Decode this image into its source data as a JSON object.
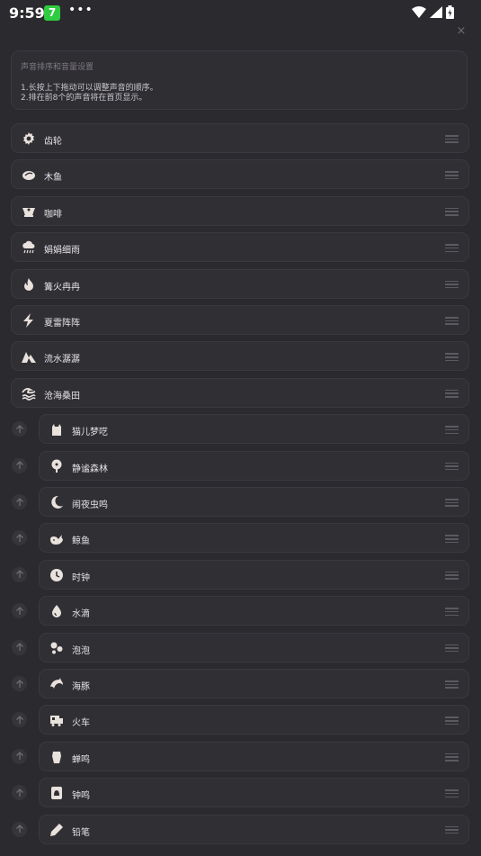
{
  "status_bar": {
    "time": "9:59",
    "app_badge": "7",
    "more": "•••"
  },
  "close_label": "×",
  "info": {
    "title": "声音排序和音量设置",
    "line1": "1.长按上下拖动可以调整声音的顺序。",
    "line2": "2.排在前8个的声音将在首页显示。"
  },
  "top_items": [
    {
      "label": "齿轮",
      "icon": "gear-icon"
    },
    {
      "label": "木鱼",
      "icon": "wooden-fish-icon"
    },
    {
      "label": "咖啡",
      "icon": "coffee-icon"
    },
    {
      "label": "娟娟细雨",
      "icon": "rain-cloud-icon"
    },
    {
      "label": "篝火冉冉",
      "icon": "fire-icon"
    },
    {
      "label": "夏雷阵阵",
      "icon": "lightning-icon"
    },
    {
      "label": "流水潺潺",
      "icon": "mountain-stream-icon"
    },
    {
      "label": "沧海桑田",
      "icon": "wave-icon"
    }
  ],
  "other_items": [
    {
      "label": "猫儿梦呓",
      "icon": "cat-icon"
    },
    {
      "label": "静谧森林",
      "icon": "tree-icon"
    },
    {
      "label": "闹夜虫鸣",
      "icon": "moon-icon"
    },
    {
      "label": "鲸鱼",
      "icon": "whale-icon"
    },
    {
      "label": "时钟",
      "icon": "clock-icon"
    },
    {
      "label": "水滴",
      "icon": "water-drop-icon"
    },
    {
      "label": "泡泡",
      "icon": "bubbles-icon"
    },
    {
      "label": "海豚",
      "icon": "dolphin-icon"
    },
    {
      "label": "火车",
      "icon": "train-icon"
    },
    {
      "label": "蝉鸣",
      "icon": "cicada-icon"
    },
    {
      "label": "钟鸣",
      "icon": "bell-icon"
    },
    {
      "label": "铅笔",
      "icon": "pencil-icon"
    }
  ]
}
